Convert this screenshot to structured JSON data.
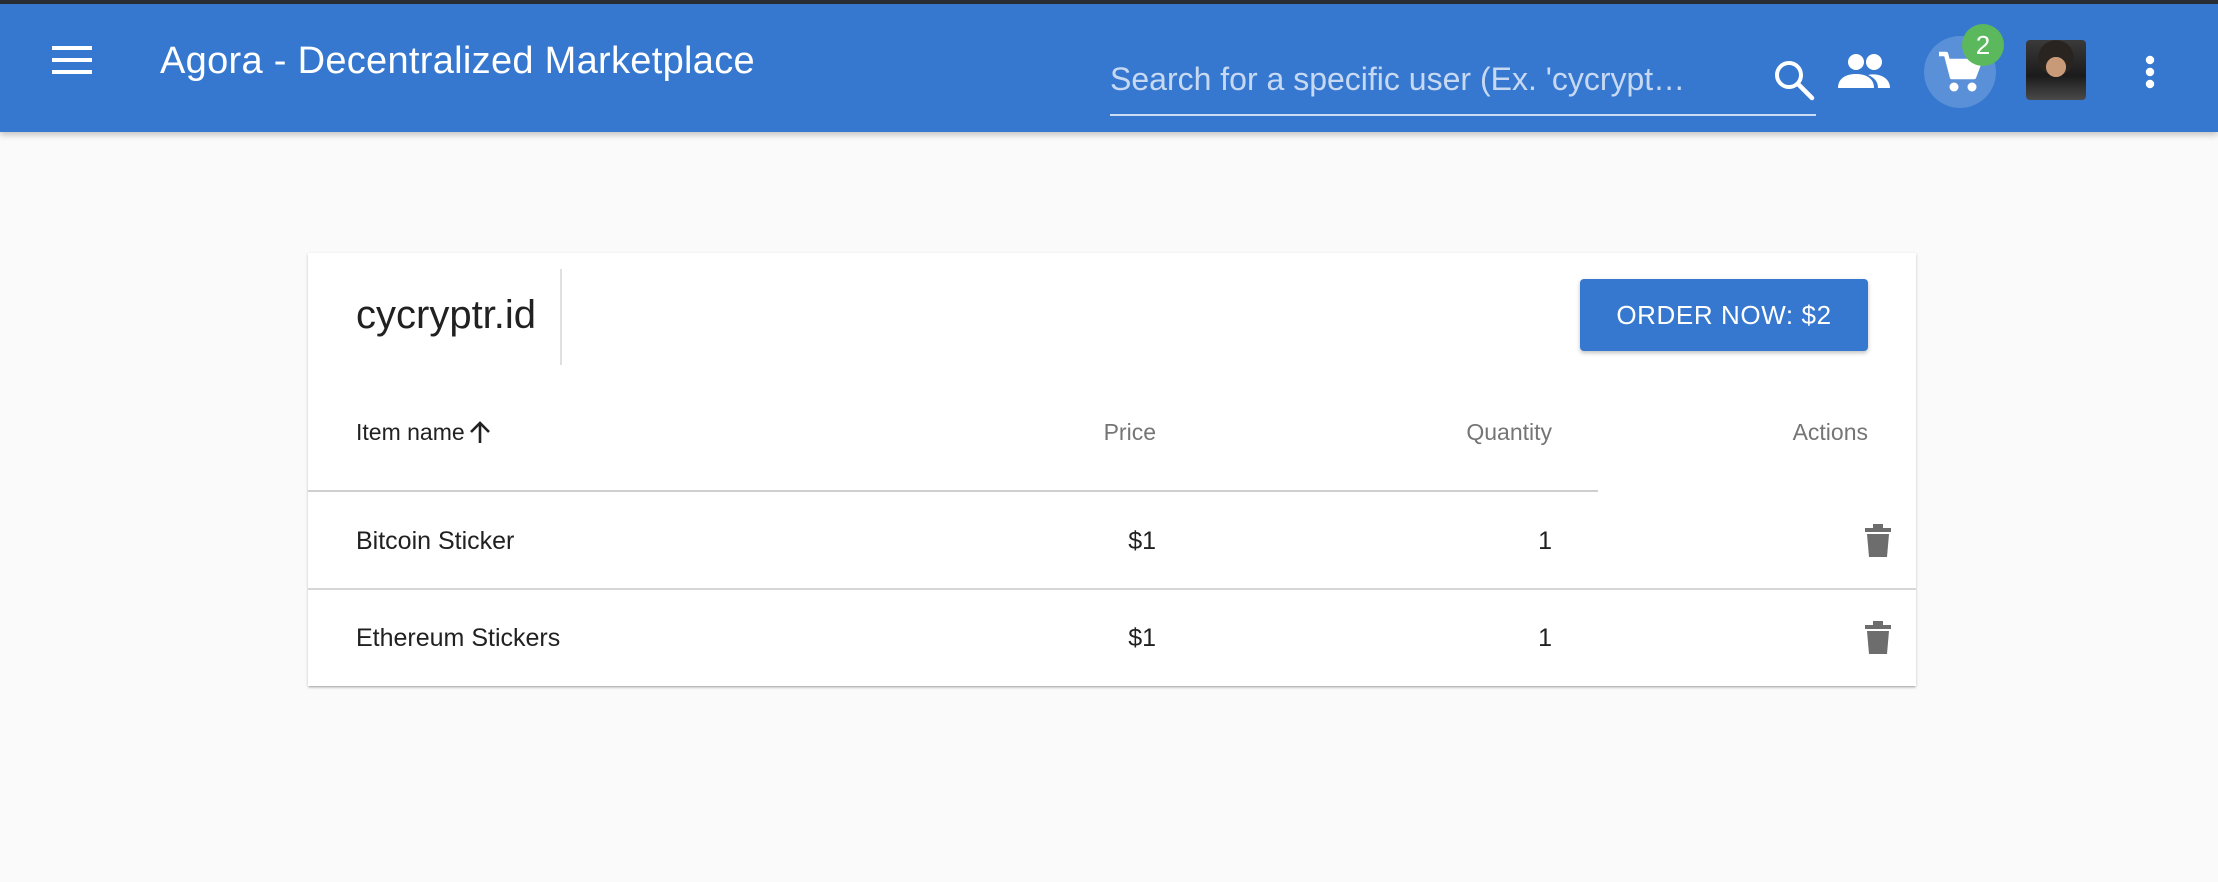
{
  "app": {
    "title": "Agora - Decentralized Marketplace",
    "accent_color": "#3678cf"
  },
  "header": {
    "search_placeholder": "Search for a specific user (Ex. 'cycrypt…",
    "cart_count": "2",
    "icons": [
      "menu-icon",
      "search-icon",
      "users-icon",
      "cart-icon",
      "avatar",
      "more-vert-icon"
    ]
  },
  "cart": {
    "seller": "cycryptr.id",
    "order_button": "ORDER NOW: $2",
    "columns": {
      "name": "Item name",
      "price": "Price",
      "quantity": "Quantity",
      "actions": "Actions"
    },
    "rows": [
      {
        "name": "Bitcoin Sticker",
        "price": "$1",
        "quantity": "1"
      },
      {
        "name": "Ethereum Stickers",
        "price": "$1",
        "quantity": "1"
      }
    ]
  }
}
